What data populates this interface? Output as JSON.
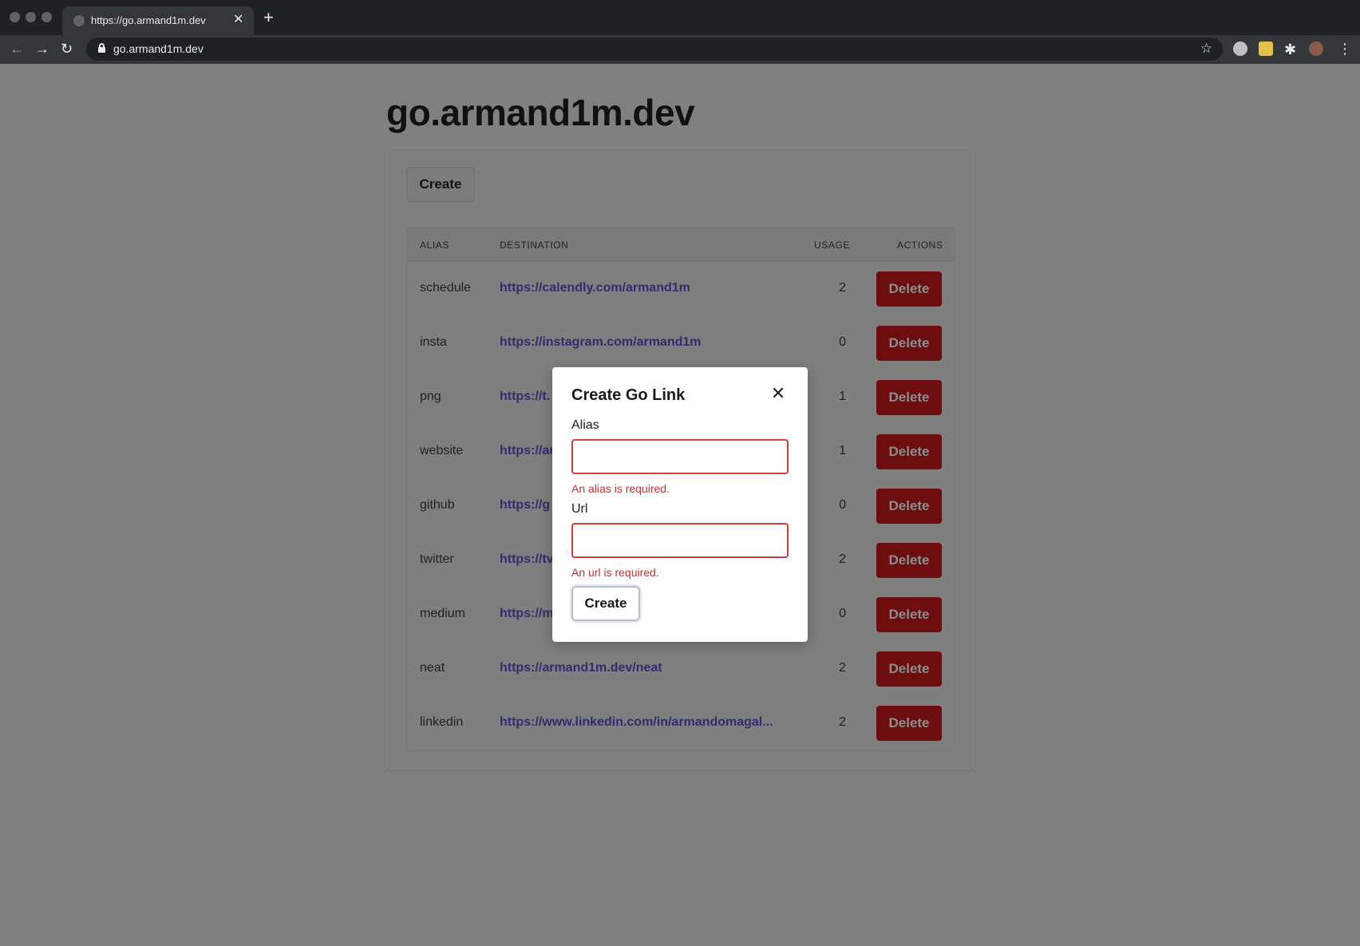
{
  "browser": {
    "tab_title": "https://go.armand1m.dev",
    "tab_close_glyph": "✕",
    "new_tab_glyph": "+",
    "address": "go.armand1m.dev",
    "back_glyph": "←",
    "forward_glyph": "→",
    "reload_glyph": "↻",
    "star_glyph": "☆",
    "menu_glyph": "⋮",
    "extensions_glyph": "✱"
  },
  "page": {
    "title": "go.armand1m.dev",
    "create_label": "Create"
  },
  "table": {
    "headers": {
      "alias": "ALIAS",
      "destination": "DESTINATION",
      "usage": "USAGE",
      "actions": "ACTIONS"
    },
    "delete_label": "Delete",
    "rows": [
      {
        "alias": "schedule",
        "destination": "https://calendly.com/armand1m",
        "usage": "2"
      },
      {
        "alias": "insta",
        "destination": "https://instagram.com/armand1m",
        "usage": "0"
      },
      {
        "alias": "png",
        "destination": "https://t.",
        "usage": "1"
      },
      {
        "alias": "website",
        "destination": "https://ar",
        "usage": "1"
      },
      {
        "alias": "github",
        "destination": "https://g",
        "usage": "0"
      },
      {
        "alias": "twitter",
        "destination": "https://tv",
        "usage": "2"
      },
      {
        "alias": "medium",
        "destination": "https://m",
        "usage": "0"
      },
      {
        "alias": "neat",
        "destination": "https://armand1m.dev/neat",
        "usage": "2"
      },
      {
        "alias": "linkedin",
        "destination": "https://www.linkedin.com/in/armandomagal...",
        "usage": "2"
      }
    ]
  },
  "modal": {
    "title": "Create Go Link",
    "close_glyph": "✕",
    "alias_label": "Alias",
    "alias_value": "",
    "alias_error": "An alias is required.",
    "url_label": "Url",
    "url_value": "",
    "url_error": "An url is required.",
    "submit_label": "Create"
  },
  "colors": {
    "overlay": "#808080",
    "delete_button": "#6d0d0d",
    "link": "#302c70",
    "error": "#c53030",
    "input_error_border": "#d83b3b"
  }
}
